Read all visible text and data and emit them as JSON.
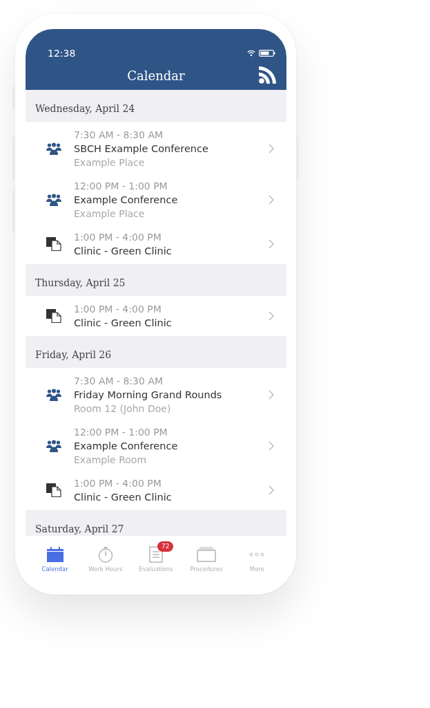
{
  "status_bar": {
    "time": "12:38"
  },
  "header": {
    "title": "Calendar"
  },
  "days": [
    {
      "date": "Wednesday, April 24",
      "events": [
        {
          "kind": "meeting",
          "time": "7:30 AM - 8:30 AM",
          "title": "SBCH Example Conference",
          "location": "Example Place"
        },
        {
          "kind": "meeting",
          "time": "12:00 PM - 1:00 PM",
          "title": "Example Conference",
          "location": "Example Place"
        },
        {
          "kind": "clinic",
          "time": "1:00 PM - 4:00 PM",
          "title": "Clinic - Green Clinic"
        }
      ]
    },
    {
      "date": "Thursday, April 25",
      "events": [
        {
          "kind": "clinic",
          "time": "1:00 PM - 4:00 PM",
          "title": "Clinic - Green Clinic"
        }
      ]
    },
    {
      "date": "Friday, April 26",
      "events": [
        {
          "kind": "meeting",
          "time": "7:30 AM - 8:30 AM",
          "title": "Friday Morning Grand Rounds",
          "location": "Room 12 (John Doe)"
        },
        {
          "kind": "meeting",
          "time": "12:00 PM - 1:00 PM",
          "title": "Example Conference",
          "location": "Example Room"
        },
        {
          "kind": "clinic",
          "time": "1:00 PM - 4:00 PM",
          "title": "Clinic - Green Clinic"
        }
      ]
    },
    {
      "date": "Saturday, April 27"
    }
  ],
  "tabs": [
    {
      "kind": "calendar",
      "label": "Calendar",
      "selected": true
    },
    {
      "kind": "stopwatch",
      "label": "Work Hours",
      "selected": false
    },
    {
      "kind": "document",
      "label": "Evaluations",
      "selected": false,
      "badge": "72"
    },
    {
      "kind": "tray",
      "label": "Procedures",
      "selected": false
    },
    {
      "kind": "more",
      "label": "More",
      "selected": false
    }
  ]
}
